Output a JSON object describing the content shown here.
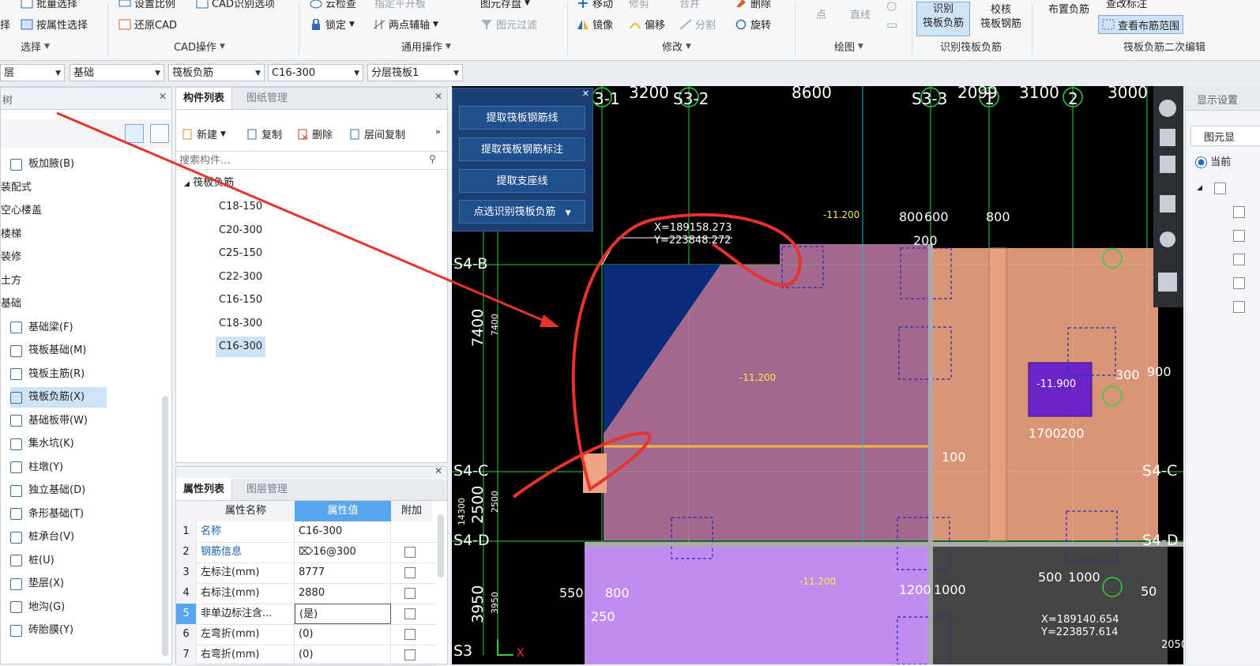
{
  "ribbon": {
    "row1": {
      "batch_select": "批量选择",
      "set_scale": "设置比例",
      "cad_recognize_options": "CAD识别选项",
      "cloud_check": "云检查",
      "specify_floor": "指定平开板",
      "element_save": "图元存盘",
      "move": "移动",
      "trim": "修剪",
      "merge": "合并",
      "delete": "删除",
      "modify_label": "查改标注"
    },
    "row2": {
      "select_partial": "择",
      "select_by_attr": "按属性选择",
      "restore_cad": "还原CAD",
      "lock": "锁定",
      "two_point_axis": "两点辅轴",
      "element_filter": "图元过滤",
      "mirror": "镜像",
      "offset": "偏移",
      "split": "分割",
      "rotate": "旋转",
      "point": "点",
      "line": "直线"
    },
    "big_buttons": {
      "recognize_top": "识别",
      "recognize_bottom": "筏板负筋",
      "check_top": "校核",
      "check_bottom": "筏板钢筋",
      "place_neg": "布置负筋",
      "view_range": "查看布筋范围"
    },
    "groups": {
      "select": "选择",
      "cad_ops": "CAD操作",
      "general_ops": "通用操作",
      "modify": "修改",
      "draw": "绘图",
      "recognize_raft": "识别筏板负筋",
      "raft_second_edit": "筏板负筋二次编辑"
    }
  },
  "dropdowns": {
    "floor": "层",
    "category": "基础",
    "component_type": "筏板负筋",
    "component": "C16-300",
    "layer": "分层筏板1"
  },
  "nav_tree": {
    "title": "树",
    "items": [
      {
        "label": "板加腋(B)",
        "icon": "haunch-icon",
        "indent": 1
      },
      {
        "label": "装配式",
        "indent": 0
      },
      {
        "label": "空心楼盖",
        "indent": 0
      },
      {
        "label": "楼梯",
        "indent": 0
      },
      {
        "label": "装修",
        "indent": 0
      },
      {
        "label": "土方",
        "indent": 0
      },
      {
        "label": "基础",
        "indent": 0
      },
      {
        "label": "基础梁(F)",
        "icon": "beam-icon",
        "indent": 1
      },
      {
        "label": "筏板基础(M)",
        "icon": "raft-icon",
        "indent": 1
      },
      {
        "label": "筏板主筋(R)",
        "icon": "main-rebar-icon",
        "indent": 1
      },
      {
        "label": "筏板负筋(X)",
        "icon": "neg-rebar-icon",
        "indent": 1,
        "selected": true
      },
      {
        "label": "基础板带(W)",
        "icon": "strip-icon",
        "indent": 1
      },
      {
        "label": "集水坑(K)",
        "icon": "sump-icon",
        "indent": 1
      },
      {
        "label": "柱墩(Y)",
        "icon": "pier-icon",
        "indent": 1
      },
      {
        "label": "独立基础(D)",
        "icon": "isolated-footing-icon",
        "indent": 1
      },
      {
        "label": "条形基础(T)",
        "icon": "strip-footing-icon",
        "indent": 1
      },
      {
        "label": "桩承台(V)",
        "icon": "pile-cap-icon",
        "indent": 1
      },
      {
        "label": "桩(U)",
        "icon": "pile-icon",
        "indent": 1
      },
      {
        "label": "垫层(X)",
        "icon": "cushion-icon",
        "indent": 1
      },
      {
        "label": "地沟(G)",
        "icon": "trench-icon",
        "indent": 1
      },
      {
        "label": "砖胎膜(Y)",
        "icon": "brick-mold-icon",
        "indent": 1
      }
    ]
  },
  "component_list": {
    "tab_active": "构件列表",
    "tab_inactive": "图纸管理",
    "toolbar": {
      "new": "新建",
      "copy": "复制",
      "delete": "删除",
      "floor_copy": "层间复制"
    },
    "search_placeholder": "搜索构件...",
    "group": "筏板负筋",
    "items": [
      "C18-150",
      "C20-300",
      "C25-150",
      "C22-300",
      "C16-150",
      "C18-300",
      "C16-300"
    ],
    "selected": "C16-300"
  },
  "properties": {
    "tab_active": "属性列表",
    "tab_inactive": "图层管理",
    "headers": [
      "属性名称",
      "属性值",
      "附加"
    ],
    "rows": [
      {
        "n": "1",
        "name": "名称",
        "value": "C16-300",
        "checkbox": false
      },
      {
        "n": "2",
        "name": "钢筋信息",
        "value": "⌦​16@300",
        "checkbox": true
      },
      {
        "n": "3",
        "name": "左标注(mm)",
        "value": "8777",
        "checkbox": true
      },
      {
        "n": "4",
        "name": "右标注(mm)",
        "value": "2880",
        "checkbox": true
      },
      {
        "n": "5",
        "name": "非单边标注含...",
        "value": "(是)",
        "checkbox": true
      },
      {
        "n": "6",
        "name": "左弯折(mm)",
        "value": "(0)",
        "checkbox": true
      },
      {
        "n": "7",
        "name": "右弯折(mm)",
        "value": "(0)",
        "checkbox": true
      }
    ]
  },
  "float_panel": {
    "buttons": [
      "提取筏板钢筋线",
      "提取筏板钢筋标注",
      "提取支座线",
      "点选识别筏板负筋"
    ]
  },
  "cad": {
    "top_labels": [
      "3-1",
      "3200",
      "S3-2",
      "8600",
      "S3-3",
      "2099",
      "1",
      "3100",
      "2",
      "3000"
    ],
    "axis_left": [
      "S4-B",
      "S4-C",
      "S4-D",
      "S3"
    ],
    "coord1": {
      "x": "X=189158.273",
      "y": "Y=223848.272"
    },
    "coord2": {
      "x": "X=189140.654",
      "y": "Y=223857.614"
    },
    "dims_left": [
      "7400",
      "7400",
      "2500",
      "2500",
      "14300",
      "3950",
      "3950"
    ],
    "dims_misc": [
      "800",
      "600",
      "800",
      "200",
      "550",
      "800",
      "250",
      "1200",
      "1000",
      "900",
      "500",
      "1000",
      "100",
      "300",
      "1700",
      "200",
      "2050",
      "50"
    ],
    "level_labels": [
      "-11.200",
      "-11.900",
      "-11.200",
      "-11.200"
    ],
    "axis_right": [
      "S4-C",
      "S4-D"
    ]
  },
  "right_panel": {
    "title": "显示设置",
    "tab": "图元显",
    "radio": "当前"
  },
  "colors": {
    "cad_bg": "#000000",
    "raft_pink": "#c98ab0",
    "raft_orange": "#f2a883",
    "raft_purple": "#c58ef0",
    "grid_green": "#33e04a",
    "annot_red": "#e8332c",
    "float_panel": "#1b3f72"
  }
}
